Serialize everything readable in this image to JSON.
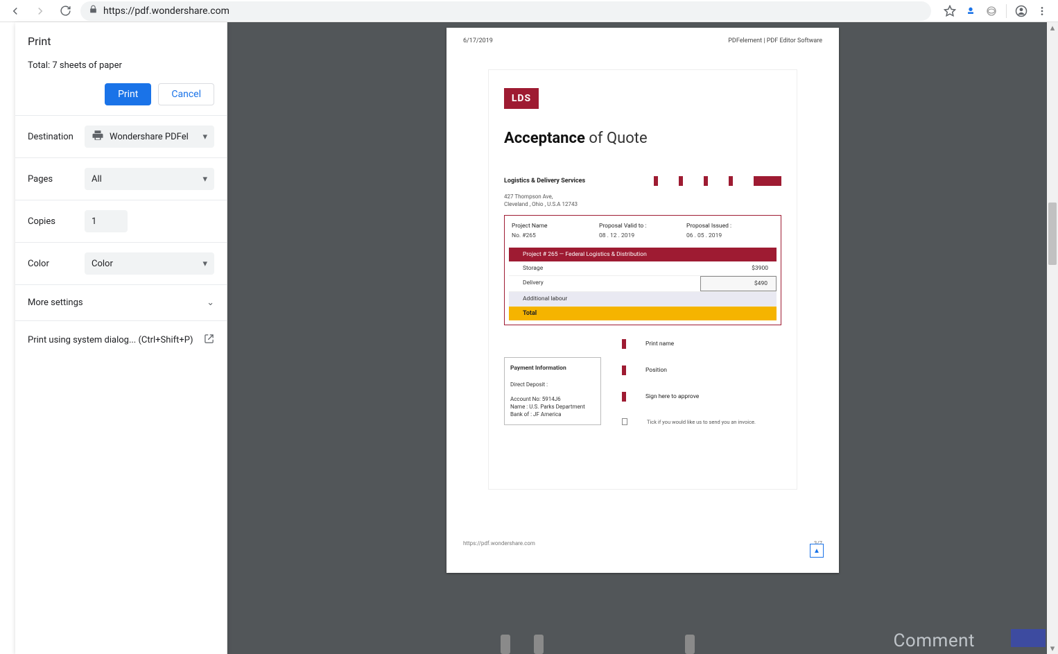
{
  "browser": {
    "url": "https://pdf.wondershare.com"
  },
  "print_panel": {
    "title": "Print",
    "total_prefix": "Total: ",
    "total_value": "7 sheets of paper",
    "print_btn": "Print",
    "cancel_btn": "Cancel",
    "destination_label": "Destination",
    "destination_value": "Wondershare PDFel",
    "pages_label": "Pages",
    "pages_value": "All",
    "copies_label": "Copies",
    "copies_value": "1",
    "color_label": "Color",
    "color_value": "Color",
    "more_settings": "More settings",
    "system_dialog": "Print using system dialog... (Ctrl+Shift+P)"
  },
  "document": {
    "header_date": "6/17/2019",
    "header_title": "PDFelement | PDF Editor Software",
    "logo": "LDS",
    "title_bold": "Acceptance",
    "title_light": " of Quote",
    "service_name": "Logistics & Delivery Services",
    "address_line1": "427 Thompson Ave,",
    "address_line2": "Cleveland , Ohio , U.S.A 12743",
    "col_project": "Project Name",
    "col_valid": "Proposal Valid to :",
    "col_issued": "Proposal Issued :",
    "val_project": "No. #265",
    "val_valid": "08 . 12 . 2019",
    "val_issued": "06 . 05 . 2019",
    "project_bar": "Project # 265 — Federal Logistics & Distribution",
    "row_storage": "Storage",
    "row_storage_amt": "$3900",
    "row_delivery": "Delivery",
    "row_delivery_amt": "$490",
    "row_additional": "Additional labour",
    "row_total": "Total",
    "pay_title": "Payment Information",
    "pay_deposit": "Direct Deposit :",
    "pay_account": "Account No: 5914J6",
    "pay_name": "Name :  U.S. Parks Department",
    "pay_bank": "Bank of :  JF America",
    "sign_print": "Print name",
    "sign_position": "Position",
    "sign_here": "Sign here to approve",
    "sign_invoice": "Tick if you would like us to send you an invoice.",
    "footer_url": "https://pdf.wondershare.com",
    "footer_page": "3/7"
  },
  "ghost": {
    "comment": "Comment"
  }
}
